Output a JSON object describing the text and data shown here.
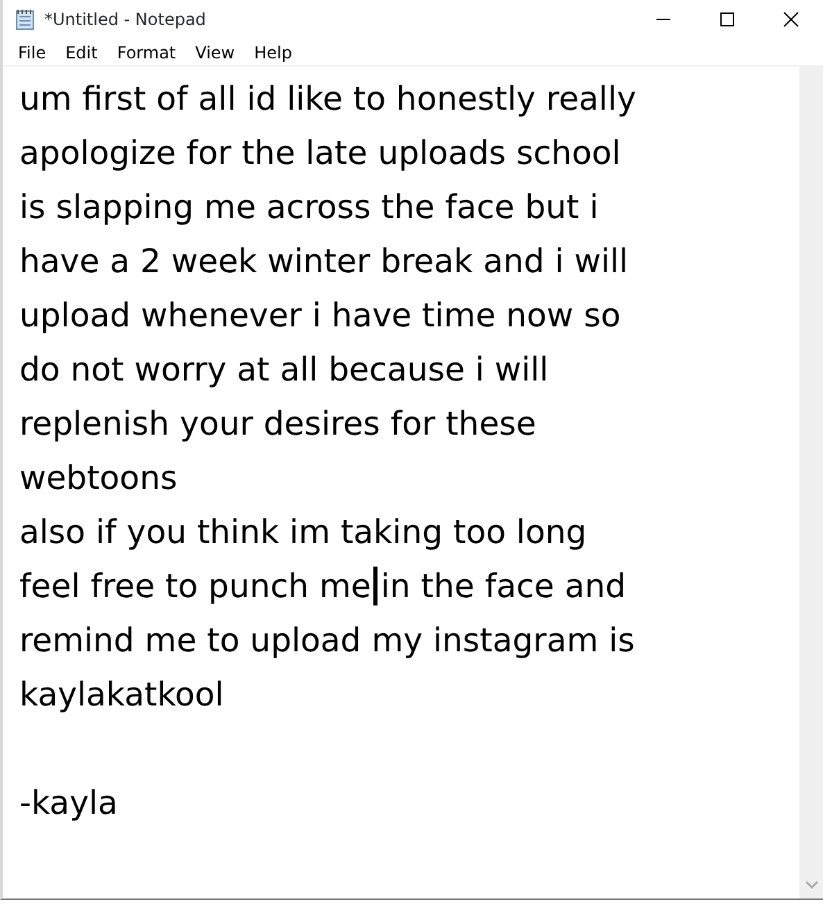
{
  "window": {
    "title": "*Untitled - Notepad"
  },
  "menu": [
    "File",
    "Edit",
    "Format",
    "View",
    "Help"
  ],
  "lines": [
    {
      "text": "um first of all id like to honestly really"
    },
    {
      "text": "apologize for the late uploads school"
    },
    {
      "text": "is slapping me across the face but i"
    },
    {
      "text": "have a 2 week winter break and i will"
    },
    {
      "text": "upload whenever i have time now so"
    },
    {
      "text": "do not worry at all because i will"
    },
    {
      "text": "replenish your desires for these"
    },
    {
      "text": "webtoons"
    },
    {
      "text": "also if you think im taking too long"
    },
    {
      "text": "feel free to punch me",
      "caret": true,
      "after_caret": "in the face and"
    },
    {
      "text": "remind me to upload my instagram is"
    },
    {
      "text": "kaylakatkool"
    },
    {
      "text": "-kayla",
      "kind": "signature"
    }
  ]
}
